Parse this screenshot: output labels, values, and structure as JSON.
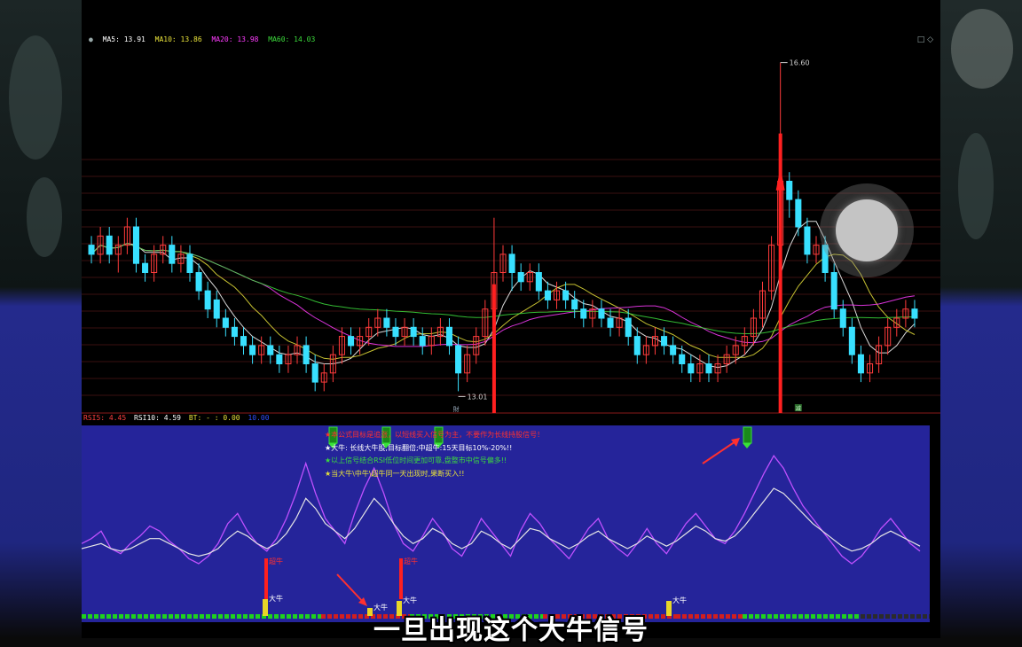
{
  "legend": {
    "items": [
      {
        "label": "MA5: 13.91",
        "color": "#ffffff"
      },
      {
        "label": "MA10: 13.86",
        "color": "#e8e23a"
      },
      {
        "label": "MA20: 13.98",
        "color": "#ff3cff"
      },
      {
        "label": "MA60: 14.03",
        "color": "#3cdc3c"
      }
    ]
  },
  "window_controls": "□ ◇",
  "rsi_legend": {
    "items": [
      {
        "label": "RSI5: 4.45",
        "color": "#ff4040"
      },
      {
        "label": "RSI10: 4.59",
        "color": "#ffffff"
      },
      {
        "label": "BT: - : 0.00",
        "color": "#e8e23a"
      },
      {
        "label": "10.00",
        "color": "#3050ff"
      }
    ]
  },
  "notes": [
    {
      "text": "★本公式目标是追涨，以短线买入信号为主，不要作为长线持股信号！",
      "color": "#ff3030"
    },
    {
      "text": "★大牛: 长线大牛股,目标翻倍;中超牛:15天目标10%-20%!!",
      "color": "#ffffff"
    },
    {
      "text": "★以上信号结合RSI低位时间更加可靠,盘整市中信号偏多!!",
      "color": "#3cdc3c"
    },
    {
      "text": "★当大牛\\中牛\\超牛同一天出现时,果断买入!!",
      "color": "#e8e23a"
    }
  ],
  "subtitle": "一旦出现这个大牛信号",
  "signal_labels": {
    "super_bull": "超牛",
    "big_bull": "大牛",
    "marker": "財",
    "marker2": "减"
  },
  "colors": {
    "up": "#ff3b3b",
    "down": "#38e0ff",
    "rsi_bg": "#25249a",
    "rsi5": "#c050ff",
    "rsi10": "#e6e6e6"
  },
  "chart_data": {
    "type": "candlestick",
    "price_annotations": {
      "high": "16.60",
      "low": "13.01"
    },
    "ylim": [
      12.8,
      16.8
    ],
    "moving_averages": [
      {
        "name": "MA5",
        "value": 13.91
      },
      {
        "name": "MA10",
        "value": 13.86
      },
      {
        "name": "MA20",
        "value": 13.98
      },
      {
        "name": "MA60",
        "value": 14.03
      }
    ],
    "candles": [
      [
        14.6,
        14.5,
        14.7,
        14.4
      ],
      [
        14.5,
        14.7,
        14.8,
        14.4
      ],
      [
        14.7,
        14.5,
        14.8,
        14.4
      ],
      [
        14.5,
        14.6,
        14.7,
        14.3
      ],
      [
        14.6,
        14.8,
        14.9,
        14.5
      ],
      [
        14.8,
        14.4,
        14.9,
        14.3
      ],
      [
        14.4,
        14.3,
        14.5,
        14.2
      ],
      [
        14.3,
        14.5,
        14.6,
        14.2
      ],
      [
        14.5,
        14.6,
        14.7,
        14.4
      ],
      [
        14.6,
        14.4,
        14.7,
        14.3
      ],
      [
        14.4,
        14.5,
        14.6,
        14.3
      ],
      [
        14.5,
        14.3,
        14.6,
        14.2
      ],
      [
        14.3,
        14.1,
        14.4,
        14.0
      ],
      [
        14.1,
        13.9,
        14.2,
        13.8
      ],
      [
        14.0,
        13.8,
        14.1,
        13.7
      ],
      [
        13.8,
        13.7,
        13.9,
        13.6
      ],
      [
        13.7,
        13.6,
        13.8,
        13.5
      ],
      [
        13.6,
        13.5,
        13.7,
        13.4
      ],
      [
        13.5,
        13.4,
        13.6,
        13.3
      ],
      [
        13.4,
        13.5,
        13.6,
        13.3
      ],
      [
        13.5,
        13.4,
        13.6,
        13.3
      ],
      [
        13.4,
        13.3,
        13.5,
        13.2
      ],
      [
        13.3,
        13.4,
        13.5,
        13.2
      ],
      [
        13.4,
        13.5,
        13.6,
        13.3
      ],
      [
        13.5,
        13.3,
        13.6,
        13.2
      ],
      [
        13.3,
        13.1,
        13.4,
        13.0
      ],
      [
        13.1,
        13.2,
        13.3,
        13.0
      ],
      [
        13.2,
        13.4,
        13.5,
        13.1
      ],
      [
        13.4,
        13.6,
        13.7,
        13.3
      ],
      [
        13.6,
        13.5,
        13.7,
        13.4
      ],
      [
        13.5,
        13.6,
        13.7,
        13.4
      ],
      [
        13.6,
        13.7,
        13.8,
        13.5
      ],
      [
        13.7,
        13.8,
        13.9,
        13.6
      ],
      [
        13.8,
        13.7,
        13.9,
        13.6
      ],
      [
        13.7,
        13.6,
        13.8,
        13.5
      ],
      [
        13.6,
        13.7,
        13.8,
        13.5
      ],
      [
        13.7,
        13.6,
        13.8,
        13.5
      ],
      [
        13.6,
        13.5,
        13.7,
        13.4
      ],
      [
        13.5,
        13.6,
        13.7,
        13.4
      ],
      [
        13.6,
        13.7,
        13.8,
        13.5
      ],
      [
        13.7,
        13.5,
        13.8,
        13.4
      ],
      [
        13.5,
        13.2,
        13.6,
        13.0
      ],
      [
        13.2,
        13.4,
        13.5,
        13.1
      ],
      [
        13.4,
        13.6,
        13.7,
        13.3
      ],
      [
        13.6,
        13.9,
        14.0,
        13.5
      ],
      [
        13.9,
        14.3,
        14.9,
        13.8
      ],
      [
        14.3,
        14.5,
        14.6,
        14.2
      ],
      [
        14.5,
        14.3,
        14.6,
        14.1
      ],
      [
        14.3,
        14.2,
        14.4,
        14.1
      ],
      [
        14.2,
        14.3,
        14.4,
        14.1
      ],
      [
        14.3,
        14.1,
        14.4,
        14.0
      ],
      [
        14.1,
        14.0,
        14.2,
        13.9
      ],
      [
        14.0,
        14.1,
        14.2,
        13.9
      ],
      [
        14.1,
        14.0,
        14.2,
        13.9
      ],
      [
        14.0,
        13.9,
        14.1,
        13.8
      ],
      [
        13.9,
        13.8,
        14.0,
        13.7
      ],
      [
        13.8,
        13.9,
        14.0,
        13.7
      ],
      [
        13.9,
        13.8,
        14.0,
        13.7
      ],
      [
        13.8,
        13.7,
        13.9,
        13.6
      ],
      [
        13.7,
        13.8,
        13.9,
        13.6
      ],
      [
        13.8,
        13.6,
        13.9,
        13.5
      ],
      [
        13.6,
        13.4,
        13.7,
        13.3
      ],
      [
        13.4,
        13.5,
        13.6,
        13.3
      ],
      [
        13.5,
        13.6,
        13.7,
        13.4
      ],
      [
        13.6,
        13.5,
        13.7,
        13.4
      ],
      [
        13.5,
        13.4,
        13.6,
        13.3
      ],
      [
        13.4,
        13.3,
        13.5,
        13.2
      ],
      [
        13.3,
        13.2,
        13.4,
        13.1
      ],
      [
        13.2,
        13.3,
        13.4,
        13.1
      ],
      [
        13.3,
        13.2,
        13.4,
        13.1
      ],
      [
        13.2,
        13.3,
        13.4,
        13.1
      ],
      [
        13.3,
        13.4,
        13.5,
        13.2
      ],
      [
        13.4,
        13.5,
        13.6,
        13.3
      ],
      [
        13.5,
        13.6,
        13.7,
        13.4
      ],
      [
        13.6,
        13.8,
        13.9,
        13.5
      ],
      [
        13.8,
        14.1,
        14.2,
        13.7
      ],
      [
        14.1,
        14.6,
        14.7,
        14.0
      ],
      [
        14.6,
        15.3,
        16.6,
        14.5
      ],
      [
        15.3,
        15.1,
        15.4,
        14.9
      ],
      [
        15.1,
        14.8,
        15.2,
        14.7
      ],
      [
        14.8,
        14.5,
        14.9,
        14.4
      ],
      [
        14.5,
        14.6,
        14.7,
        14.4
      ],
      [
        14.6,
        14.3,
        14.7,
        14.2
      ],
      [
        14.3,
        13.9,
        14.4,
        13.8
      ],
      [
        13.9,
        13.7,
        14.0,
        13.6
      ],
      [
        13.7,
        13.4,
        13.8,
        13.3
      ],
      [
        13.4,
        13.2,
        13.5,
        13.1
      ],
      [
        13.2,
        13.3,
        13.4,
        13.1
      ],
      [
        13.3,
        13.5,
        13.6,
        13.2
      ],
      [
        13.5,
        13.7,
        13.8,
        13.4
      ],
      [
        13.7,
        13.8,
        13.9,
        13.6
      ],
      [
        13.8,
        13.9,
        14.0,
        13.7
      ],
      [
        13.9,
        13.8,
        14.0,
        13.7
      ]
    ],
    "rsi5": [
      50,
      52,
      55,
      48,
      46,
      50,
      53,
      57,
      55,
      51,
      48,
      44,
      42,
      45,
      50,
      58,
      62,
      55,
      50,
      47,
      52,
      60,
      70,
      82,
      70,
      60,
      55,
      50,
      62,
      72,
      80,
      70,
      58,
      50,
      47,
      53,
      60,
      55,
      48,
      45,
      52,
      60,
      55,
      50,
      45,
      55,
      62,
      58,
      52,
      48,
      44,
      50,
      56,
      60,
      52,
      48,
      45,
      50,
      56,
      50,
      46,
      52,
      58,
      62,
      57,
      52,
      50,
      55,
      62,
      70,
      78,
      85,
      80,
      72,
      65,
      60,
      55,
      50,
      45,
      42,
      45,
      50,
      56,
      60,
      55,
      50,
      47
    ],
    "rsi10": [
      48,
      49,
      50,
      48,
      47,
      48,
      50,
      52,
      52,
      50,
      48,
      46,
      45,
      46,
      48,
      52,
      55,
      53,
      50,
      48,
      50,
      54,
      60,
      68,
      64,
      58,
      55,
      52,
      56,
      62,
      68,
      64,
      58,
      53,
      50,
      52,
      56,
      54,
      50,
      48,
      50,
      55,
      53,
      50,
      48,
      52,
      56,
      55,
      52,
      50,
      48,
      50,
      53,
      55,
      52,
      50,
      48,
      50,
      53,
      51,
      49,
      51,
      54,
      57,
      55,
      52,
      51,
      53,
      57,
      62,
      67,
      72,
      70,
      66,
      62,
      58,
      55,
      52,
      49,
      47,
      48,
      50,
      53,
      55,
      53,
      51,
      49
    ]
  }
}
